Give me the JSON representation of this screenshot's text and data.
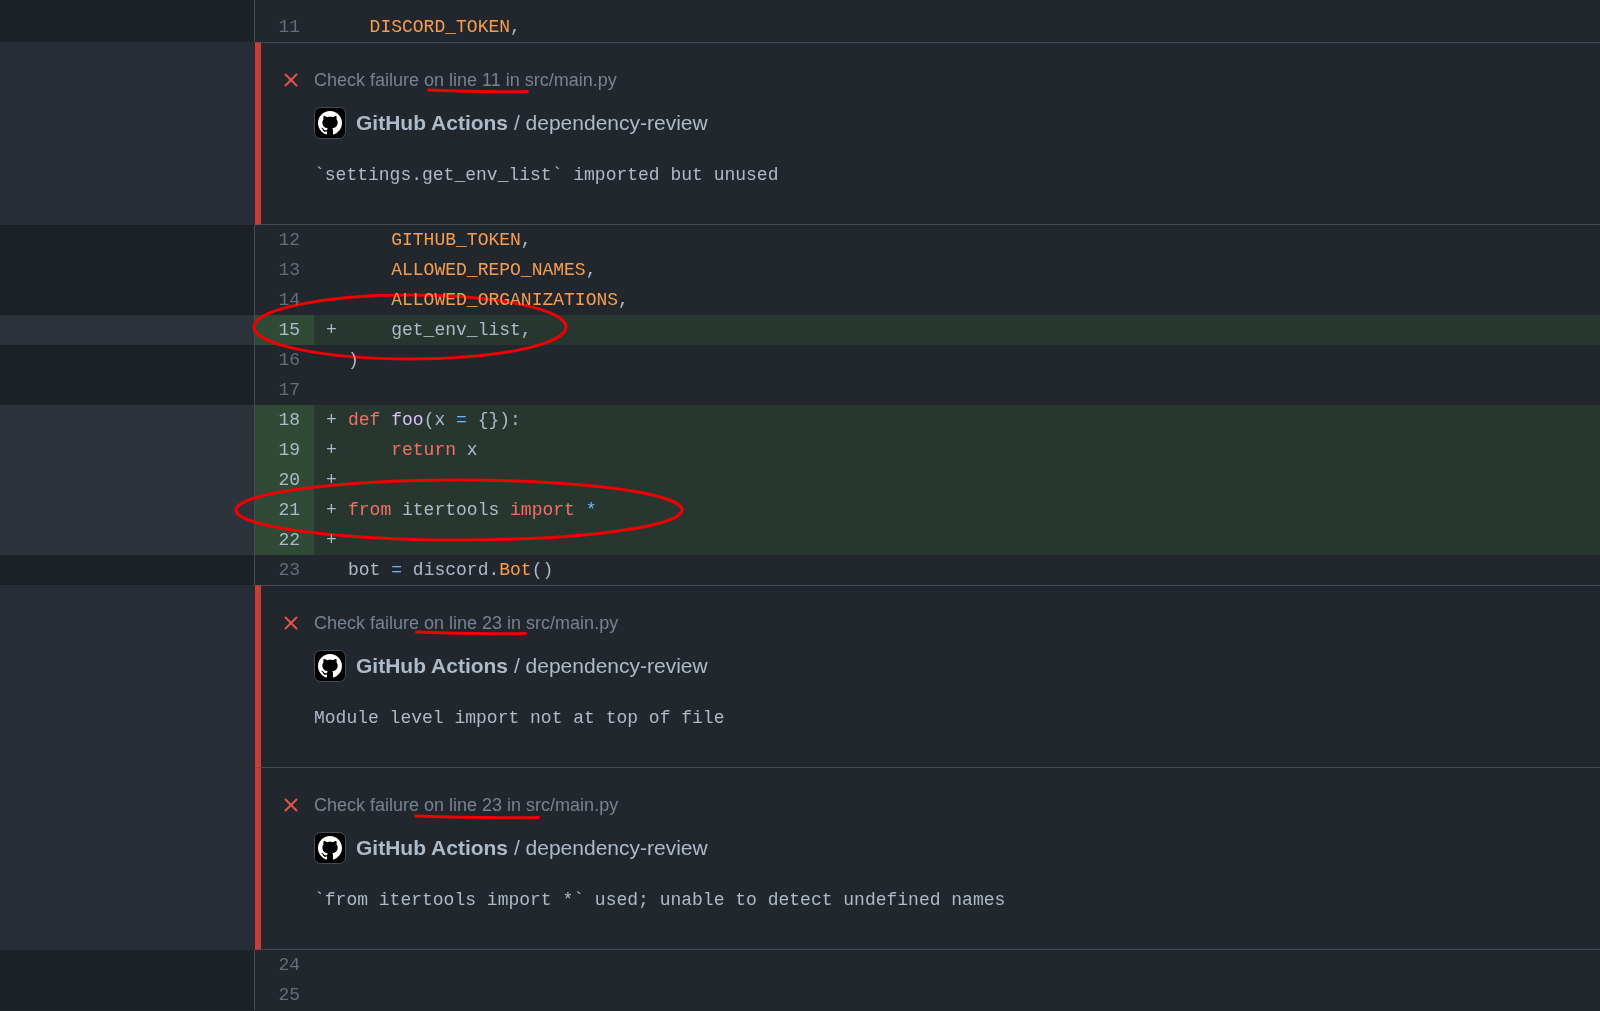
{
  "diff": {
    "rows": [
      {
        "kind": "line",
        "number": "11",
        "added": false,
        "circled": false,
        "tokens": [
          {
            "text": "  DISCORD_TOKEN",
            "kind": "constant"
          },
          {
            "text": ",",
            "kind": "plain"
          }
        ]
      },
      {
        "kind": "annotation",
        "heading": "Check failure on line 11 in src/main.py",
        "underlined": true,
        "source": "**GitHub Actions** / dependency-review",
        "message": "`settings.get_env_list` imported but unused"
      },
      {
        "kind": "line",
        "number": "12",
        "added": false,
        "circled": false,
        "tokens": [
          {
            "text": "    GITHUB_TOKEN",
            "kind": "constant"
          },
          {
            "text": ",",
            "kind": "plain"
          }
        ]
      },
      {
        "kind": "line",
        "number": "13",
        "added": false,
        "circled": false,
        "tokens": [
          {
            "text": "    ALLOWED_REPO_NAMES",
            "kind": "constant"
          },
          {
            "text": ",",
            "kind": "plain"
          }
        ]
      },
      {
        "kind": "line",
        "number": "14",
        "added": false,
        "circled": false,
        "tokens": [
          {
            "text": "    ALLOWED_ORGANIZATIONS",
            "kind": "constant"
          },
          {
            "text": ",",
            "kind": "plain"
          }
        ]
      },
      {
        "kind": "line",
        "number": "15",
        "marker": "+",
        "added": true,
        "circled": true,
        "tokens": [
          {
            "text": "    get_env_list,",
            "kind": "plain"
          }
        ]
      },
      {
        "kind": "line",
        "number": "16",
        "added": false,
        "circled": false,
        "tokens": [
          {
            "text": ")",
            "kind": "plain"
          }
        ]
      },
      {
        "kind": "line",
        "number": "17",
        "added": false,
        "circled": false
      },
      {
        "kind": "line",
        "number": "18",
        "marker": "+",
        "added": true,
        "circled": false,
        "tokens": [
          {
            "text": "def",
            "kind": "keyword"
          },
          {
            "text": " foo",
            "kind": "function"
          },
          {
            "text": "(x ",
            "kind": "plain"
          },
          {
            "text": "=",
            "kind": "operator"
          },
          {
            "text": " {}):",
            "kind": "plain"
          }
        ]
      },
      {
        "kind": "line",
        "number": "19",
        "marker": "+",
        "added": true,
        "circled": false,
        "tokens": [
          {
            "text": "    return",
            "kind": "keyword"
          },
          {
            "text": " x",
            "kind": "plain"
          }
        ]
      },
      {
        "kind": "line",
        "number": "20",
        "marker": "+",
        "added": true,
        "circled": false
      },
      {
        "kind": "line",
        "number": "21",
        "marker": "+",
        "added": true,
        "circled": true,
        "tokens": [
          {
            "text": "from",
            "kind": "keyword"
          },
          {
            "text": " itertools ",
            "kind": "plain"
          },
          {
            "text": "import",
            "kind": "keyword"
          },
          {
            "text": " *",
            "kind": "operator"
          }
        ]
      },
      {
        "kind": "line",
        "number": "22",
        "marker": "+",
        "added": true,
        "circled": false
      },
      {
        "kind": "line",
        "number": "23",
        "added": false,
        "circled": false,
        "tokens": [
          {
            "text": "bot ",
            "kind": "plain"
          },
          {
            "text": "=",
            "kind": "operator"
          },
          {
            "text": " discord.",
            "kind": "plain"
          },
          {
            "text": "Bot",
            "kind": "constant"
          },
          {
            "text": "()",
            "kind": "plain"
          }
        ]
      },
      {
        "kind": "annotation",
        "heading": "Check failure on line 23 in src/main.py",
        "underlined": true,
        "source": "**GitHub Actions** / dependency-review",
        "message": "Module level import not at top of file"
      },
      {
        "kind": "annotation",
        "heading": "Check failure on line 23 in src/main.py",
        "underlined": true,
        "source": "**GitHub Actions** / dependency-review",
        "message": "`from itertools import *` used; unable to detect undefined names"
      },
      {
        "kind": "line",
        "number": "24",
        "added": false,
        "circled": false
      },
      {
        "kind": "line",
        "number": "25",
        "added": false,
        "circled": false
      }
    ]
  }
}
